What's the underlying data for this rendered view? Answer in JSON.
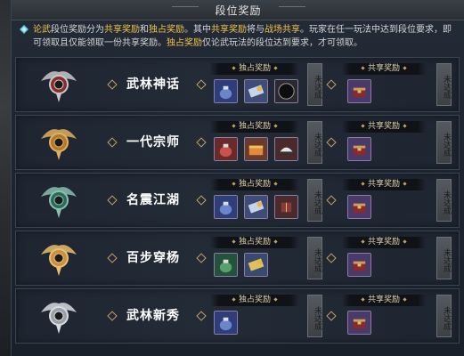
{
  "window": {
    "title": "段位奖励"
  },
  "info": {
    "segments": [
      {
        "t": "论武",
        "hl": true
      },
      {
        "t": "段位奖励分为",
        "hl": false
      },
      {
        "t": "共享奖励",
        "hl": true
      },
      {
        "t": "和",
        "hl": false
      },
      {
        "t": "独占奖励",
        "hl": true
      },
      {
        "t": "。其中",
        "hl": false
      },
      {
        "t": "共享奖励",
        "hl": true
      },
      {
        "t": "将与",
        "hl": false
      },
      {
        "t": "战场共享",
        "hl": true
      },
      {
        "t": "。玩家在任一玩法中达到段位要求，即可领取且仅能领取一份共享奖励。",
        "hl": false
      },
      {
        "t": "独占奖励",
        "hl": true
      },
      {
        "t": "仅论武玩法的段位达到要求，才可领取。",
        "hl": false
      }
    ]
  },
  "labels": {
    "exclusive": "独占奖励",
    "shared": "共享奖励",
    "status": "未达成"
  },
  "tiers": [
    {
      "name": "武林神话",
      "excl_items": [
        "pouch-blue",
        "scroll-silver",
        "orb-dark"
      ],
      "shared_items": [
        "chest-purple"
      ]
    },
    {
      "name": "一代宗师",
      "excl_items": [
        "pouch-red",
        "chest-gold",
        "hat-white"
      ],
      "shared_items": [
        "chest-purple"
      ]
    },
    {
      "name": "名震江湖",
      "excl_items": [
        "pouch-blue",
        "scroll-silver",
        "box-red"
      ],
      "shared_items": [
        "chest-purple"
      ]
    },
    {
      "name": "百步穿杨",
      "excl_items": [
        "pouch-green",
        "scroll-gold"
      ],
      "shared_items": [
        "chest-purple"
      ]
    },
    {
      "name": "武林新秀",
      "excl_items": [
        "pouch-blue"
      ],
      "shared_items": [
        "chest-purple"
      ]
    }
  ],
  "colors": {
    "highlight": "#f2c14a",
    "text": "#d6d6d6",
    "header_text": "#e0d3b0"
  }
}
